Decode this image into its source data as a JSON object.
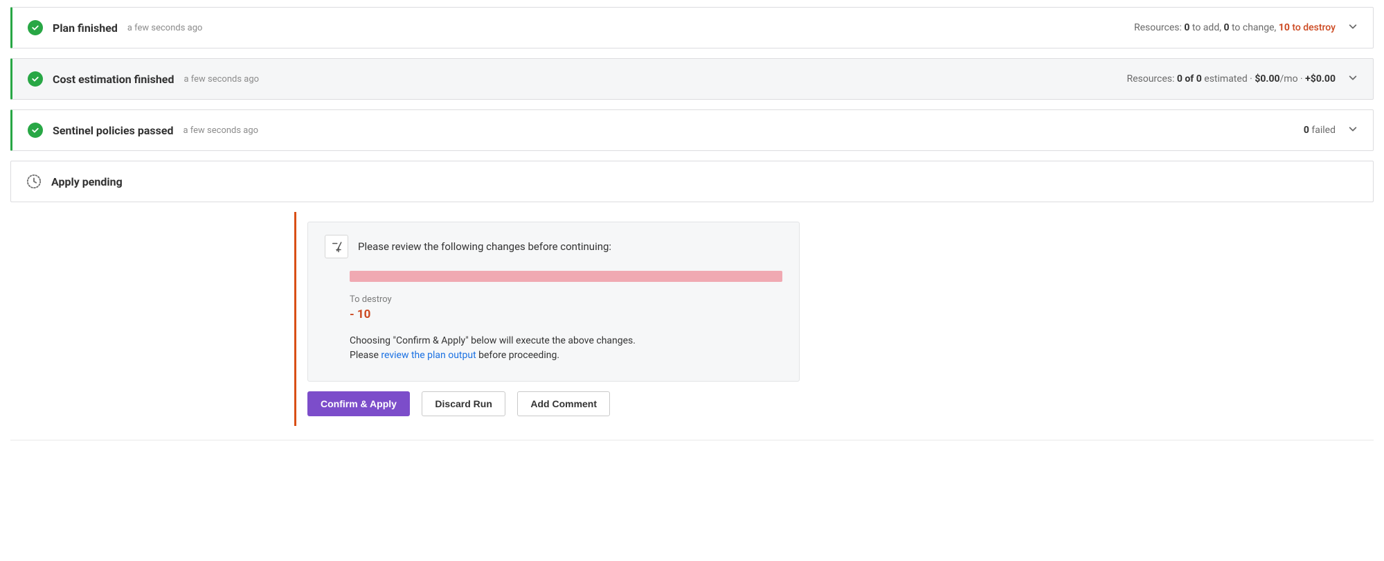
{
  "cards": {
    "plan": {
      "title": "Plan finished",
      "timestamp": "a few seconds ago",
      "summary_prefix": "Resources: ",
      "add_count": "0",
      "add_label": " to add, ",
      "change_count": "0",
      "change_label": " to change, ",
      "destroy_count": "10",
      "destroy_label": " to destroy"
    },
    "cost": {
      "title": "Cost estimation finished",
      "timestamp": "a few seconds ago",
      "summary_prefix": "Resources: ",
      "estimated_count": "0 of 0",
      "estimated_label": " estimated · ",
      "cost_mo_value": "$0.00",
      "cost_mo_label": "/mo · ",
      "delta": "+$0.00"
    },
    "sentinel": {
      "title": "Sentinel policies passed",
      "timestamp": "a few seconds ago",
      "failed_count": "0",
      "failed_label": " failed"
    },
    "apply": {
      "title": "Apply pending"
    }
  },
  "review": {
    "header": "Please review the following changes before continuing:",
    "to_destroy_label": "To destroy",
    "to_destroy_value": "- 10",
    "warn_line1": "Choosing \"Confirm & Apply\" below will execute the above changes.",
    "warn_line2a": "Please ",
    "warn_link": "review the plan output",
    "warn_line2b": " before proceeding."
  },
  "buttons": {
    "confirm": "Confirm & Apply",
    "discard": "Discard Run",
    "comment": "Add Comment"
  }
}
